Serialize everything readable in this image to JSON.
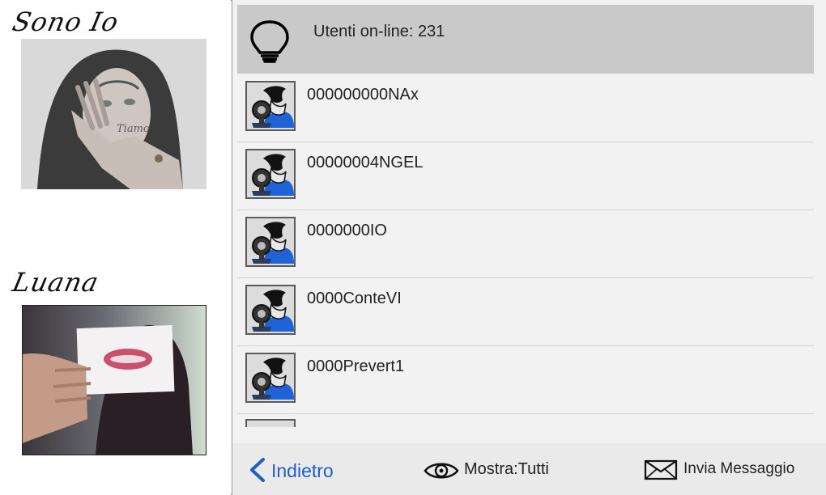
{
  "sidebar": {
    "self_label": "Sono Io",
    "contact_label": "Luana"
  },
  "header": {
    "online_text": "Utenti on-line: 231",
    "icon": "lightbulb-icon"
  },
  "users": [
    {
      "name": "000000000NAx"
    },
    {
      "name": "00000004NGEL"
    },
    {
      "name": "0000000IO"
    },
    {
      "name": "0000ConteVI"
    },
    {
      "name": "0000Prevert1"
    }
  ],
  "footer": {
    "back_label": "Indietro",
    "filter_label": "Mostra:Tutti",
    "message_label": "Invia Messaggio",
    "icons": [
      "chevron-left-icon",
      "eye-icon",
      "envelope-icon"
    ]
  },
  "colors": {
    "accent": "#1b5fc7",
    "header_bg": "#c9c9c9",
    "list_bg": "#f2f2f2",
    "avatar_blue": "#1f63d6"
  }
}
